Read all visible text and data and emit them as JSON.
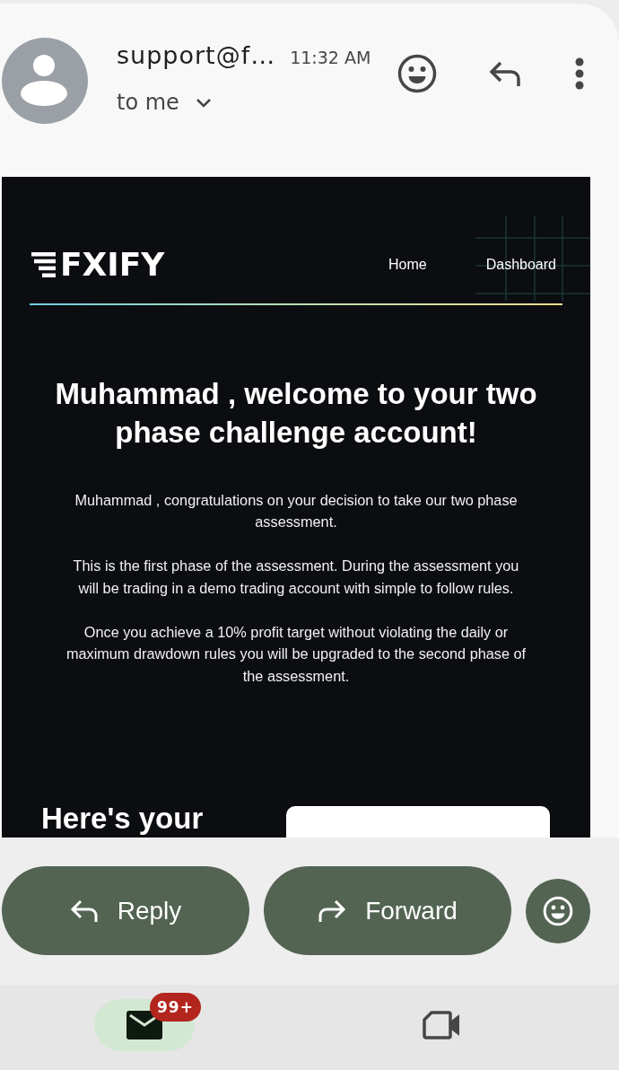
{
  "message_header": {
    "sender": "support@f…",
    "time": "11:32 AM",
    "recipient": "to me"
  },
  "email": {
    "logo": "FXIFY",
    "nav_links": [
      "Home",
      "Dashboard"
    ],
    "heading": "Muhammad , welcome to your two phase challenge account!",
    "paragraphs": [
      "Muhammad , congratulations on your decision to take our two phase assessment.",
      "This is the first phase of the assessment. During the assessment you will be trading in a demo trading account with simple to follow rules.",
      "Once you achieve a 10% profit target without violating the daily or maximum drawdown rules you will be upgraded to the second phase of the assessment."
    ],
    "section_heading": "Here's your"
  },
  "actions": [
    {
      "kind": "reply",
      "label": "Reply"
    },
    {
      "kind": "forward",
      "label": "Forward"
    },
    {
      "kind": "react"
    }
  ],
  "bottom_nav": [
    {
      "kind": "mail",
      "selected": true,
      "badge": "99+"
    },
    {
      "kind": "video",
      "selected": false
    }
  ]
}
